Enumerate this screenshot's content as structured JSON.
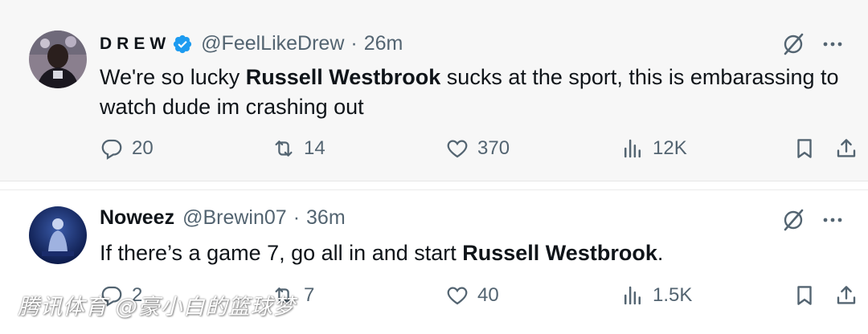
{
  "tweets": [
    {
      "display_name": "DREW",
      "verified": true,
      "handle": "@FeelLikeDrew",
      "separator": "·",
      "time": "26m",
      "text_before": "We're so lucky ",
      "text_bold": "Russell Westbrook",
      "text_after": " sucks at the sport, this is embarassing to watch dude im crashing out",
      "replies": "20",
      "reposts": "14",
      "likes": "370",
      "views": "12K"
    },
    {
      "display_name": "Noweez",
      "verified": false,
      "handle": "@Brewin07",
      "separator": "·",
      "time": "36m",
      "text_before": "If there’s a game 7, go all in and start ",
      "text_bold": "Russell Westbrook",
      "text_after": ".",
      "replies": "2",
      "reposts": "7",
      "likes": "40",
      "views": "1.5K"
    }
  ],
  "watermark": "腾讯体育 @豪小白的篮球梦",
  "colors": {
    "text": "#0f1419",
    "secondary": "#536471",
    "verified_blue": "#1d9bf0",
    "tweet1_bg": "#f7f7f7"
  },
  "icons": [
    "verified-badge-icon",
    "grok-icon",
    "more-icon",
    "reply-icon",
    "repost-icon",
    "like-icon",
    "views-icon",
    "bookmark-icon",
    "share-icon"
  ]
}
